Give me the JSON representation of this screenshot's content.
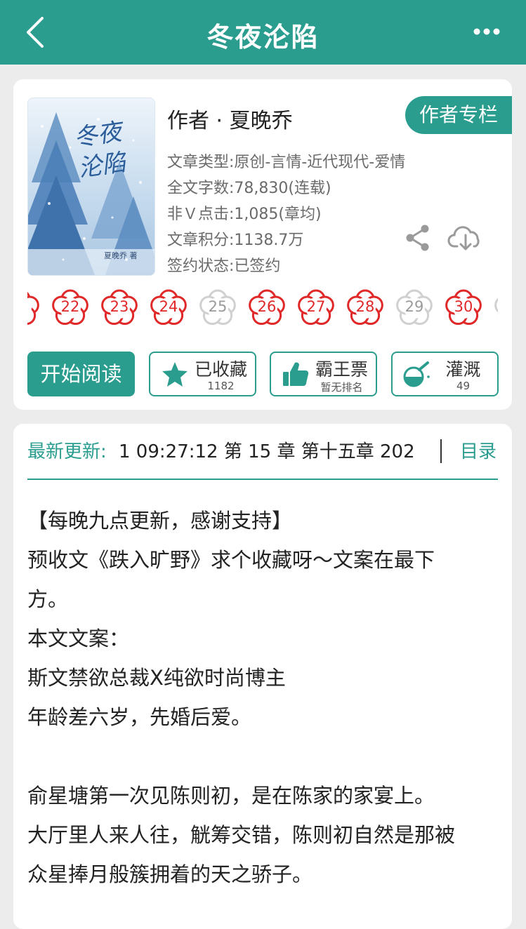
{
  "header": {
    "title": "冬夜沦陷"
  },
  "book": {
    "cover_title": "冬夜沦陷",
    "cover_author": "夏晚乔 著",
    "author_line": "作者 · 夏晚乔",
    "author_column_label": "作者专栏",
    "meta": [
      "文章类型:原创-言情-近代现代-爱情",
      "全文字数:78,830(连载)",
      "非Ｖ点击:1,085(章均)",
      "文章积分:1138.7万",
      "签约状态:已签约"
    ]
  },
  "flowers": [
    {
      "num": "",
      "active": true
    },
    {
      "num": "22",
      "active": true
    },
    {
      "num": "23",
      "active": true
    },
    {
      "num": "24",
      "active": true
    },
    {
      "num": "25",
      "active": false
    },
    {
      "num": "26",
      "active": true
    },
    {
      "num": "27",
      "active": true
    },
    {
      "num": "28",
      "active": true
    },
    {
      "num": "29",
      "active": false
    },
    {
      "num": "30",
      "active": true
    },
    {
      "num": "",
      "active": false
    }
  ],
  "actions": {
    "read_label": "开始阅读",
    "favorite_label": "已收藏",
    "favorite_count": "1182",
    "vote_label": "霸王票",
    "vote_sub": "暂无排名",
    "nutrient_label": "灌溉",
    "nutrient_count": "49"
  },
  "update": {
    "label": "最新更新:",
    "text": "1 09:27:12   第 15 章  第十五章  202",
    "toc_label": "目录"
  },
  "description": [
    "【每晚九点更新，感谢支持】",
    "预收文《跌入旷野》求个收藏呀～文案在最下",
    "方。",
    "本文文案：",
    "斯文禁欲总裁X纯欲时尚博主",
    "年龄差六岁，先婚后爱。",
    "",
    "俞星塘第一次见陈则初，是在陈家的家宴上。",
    "大厅里人来人往，觥筹交错，陈则初自然是那被",
    "众星捧月般簇拥着的天之骄子。"
  ],
  "colors": {
    "accent": "#2a9d8f",
    "flower_active": "#e02828",
    "flower_inactive": "#d0d0d0"
  }
}
